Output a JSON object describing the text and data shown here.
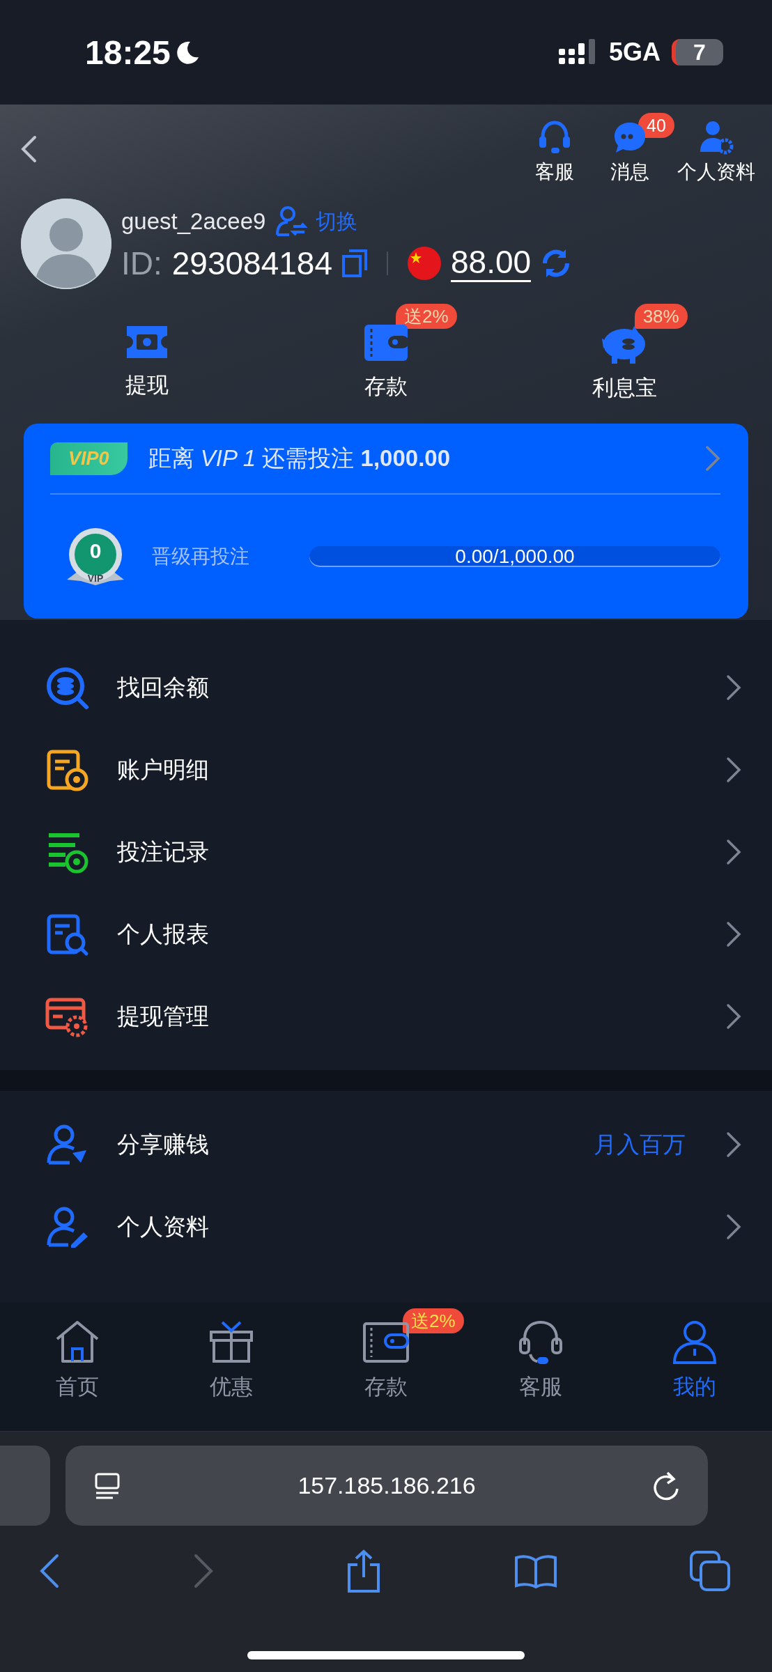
{
  "status_bar": {
    "time": "18:25",
    "network": "5GA",
    "battery": "7"
  },
  "header": {
    "actions": [
      {
        "label": "客服"
      },
      {
        "label": "消息",
        "badge": "40"
      },
      {
        "label": "个人资料"
      }
    ]
  },
  "profile": {
    "username": "guest_2acee9",
    "switch_label": "切换",
    "id_label": "ID:",
    "id": "293084184",
    "balance": "88.00"
  },
  "quick_actions": [
    {
      "label": "提现"
    },
    {
      "label": "存款",
      "badge": "送2%"
    },
    {
      "label": "利息宝",
      "badge": "38%"
    }
  ],
  "vip": {
    "tag": "VIP0",
    "message": "距离 *VIP 1* 还需投注 **1,000.00**",
    "medal_level": "0",
    "medal_text": "VIP",
    "progress_label": "晋级再投注",
    "progress_text": "0.00/1,000.00",
    "level": 0
  },
  "menu_sections": [
    {
      "items": [
        {
          "label": "找回余额"
        },
        {
          "label": "账户明细"
        },
        {
          "label": "投注记录"
        },
        {
          "label": "个人报表"
        },
        {
          "label": "提现管理"
        }
      ]
    },
    {
      "items": [
        {
          "label": "分享赚钱",
          "value": "月入百万"
        },
        {
          "label": "个人资料"
        }
      ]
    }
  ],
  "bottom_nav": [
    {
      "label": "首页",
      "selected": false
    },
    {
      "label": "优惠",
      "selected": false
    },
    {
      "label": "存款",
      "selected": false,
      "badge": "送2%"
    },
    {
      "label": "客服",
      "selected": false
    },
    {
      "label": "我的",
      "selected": true
    }
  ],
  "browser": {
    "url": "157.185.186.216"
  }
}
